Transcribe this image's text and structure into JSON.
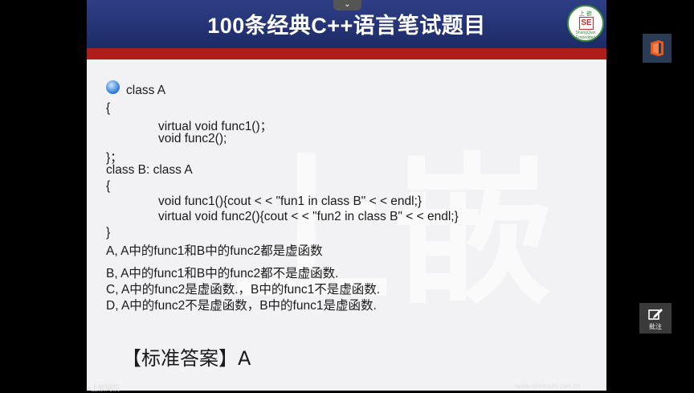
{
  "slide": {
    "title": "100条经典C++语言笔试题目",
    "logo": {
      "top_text": "上 嵌",
      "center": "SE",
      "bottom_text": "ShangQian Embedded"
    },
    "watermark": "上嵌",
    "code_lines": [
      "class A",
      "{",
      "virtual void func1()；",
      "void func2();",
      "}；",
      "class B: class A",
      "{",
      "void func1(){cout < < \"fun1 in class B\" < < endl;}",
      "virtual void func2(){cout < < \"fun2 in class B\" < < endl;}",
      "}"
    ],
    "options": [
      "A, A中的func1和B中的func2都是虚函数",
      "B, A中的func1和B中的func2都不是虚函数.",
      "C, A中的func2是虚函数.，B中的func1不是虚函数.",
      "D, A中的func2不是虚函数，B中的func1是虚函数."
    ],
    "answer": "【标准答案】A",
    "footer_left": "•上嵌网院",
    "footer_right": "•www.qianrushi.com.cn"
  },
  "controls": {
    "collapse_glyph": "⌄",
    "annotate_label": "批注"
  },
  "colors": {
    "header_blue": "#2e3f86",
    "accent_red": "#b01c1c",
    "office_orange": "#e85a1c"
  }
}
